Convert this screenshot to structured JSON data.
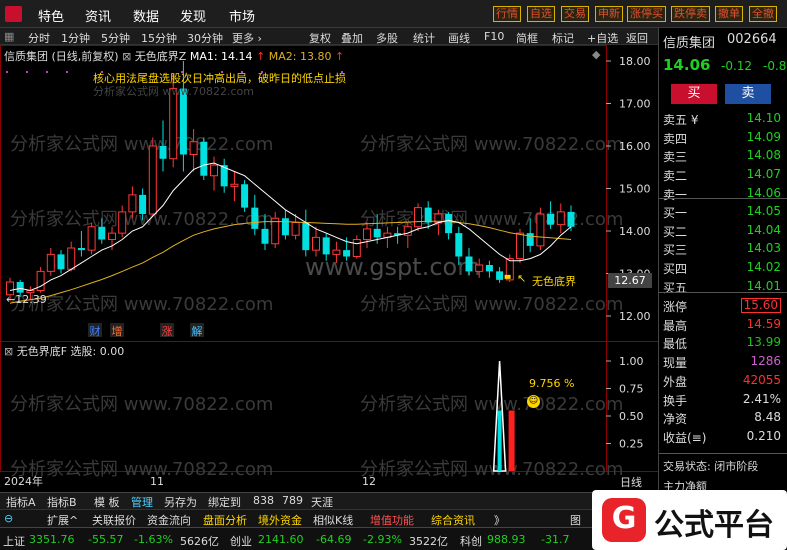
{
  "topbar": {
    "menu": [
      "特色",
      "资讯",
      "数据",
      "发现",
      "市场"
    ],
    "buttons": [
      "行情",
      "自选",
      "交易",
      "申新",
      "涨停买",
      "跌停卖",
      "撤单",
      "全撤"
    ]
  },
  "periodbar": {
    "items": [
      "分时",
      "1分钟",
      "5分钟",
      "15分钟",
      "30分钟",
      "更多 ›"
    ],
    "tools": [
      "复权",
      "叠加",
      "多股",
      "统计",
      "画线",
      "F10",
      "简框",
      "标记",
      "+自选",
      "返回"
    ]
  },
  "chart": {
    "title_line": {
      "stock": "信质集团 (日线,前复权)",
      "indicator": "无色底界Z",
      "ma1_label": "MA1: 14.14",
      "ma1_arrow": "↑",
      "ma2_label": "MA2: 13.80",
      "ma2_arrow": "↑"
    },
    "annotation_text": "核心用法尾盘选股次日冲高出局，破昨日的低点止损",
    "source_watermark": "分析家公式网 www.70822.com",
    "center_watermark": "www.gspt.com",
    "grid_watermark": "分析家公式网 www.70822.com",
    "low_marker": "←12.39",
    "current_price_tag": "12.67",
    "signal_label": "无色底界",
    "event_labels": [
      "财",
      "增",
      "涨",
      "解"
    ],
    "price_axis": [
      "18.00",
      "17.00",
      "16.00",
      "15.00",
      "14.00",
      "13.00",
      "12.00"
    ],
    "sub_title": {
      "name": "无色界底F",
      "value": "选股: 0.00"
    },
    "sub_axis": [
      "1.00",
      "0.75",
      "0.50",
      "0.25"
    ],
    "sub_pct_label": "9.756 %",
    "date_axis": [
      "2024年",
      "11",
      "12"
    ],
    "period_label": "日线"
  },
  "chart_data": {
    "type": "candlestick",
    "ylim": [
      11.7,
      18.3
    ],
    "candles": [
      [
        12.5,
        12.9,
        12.35,
        12.8
      ],
      [
        12.8,
        12.85,
        12.45,
        12.55
      ],
      [
        12.55,
        12.7,
        12.39,
        12.6
      ],
      [
        12.6,
        13.15,
        12.55,
        13.05
      ],
      [
        13.05,
        13.6,
        12.95,
        13.45
      ],
      [
        13.45,
        13.55,
        13.0,
        13.1
      ],
      [
        13.1,
        13.75,
        13.05,
        13.6
      ],
      [
        13.6,
        14.0,
        13.4,
        13.55
      ],
      [
        13.55,
        14.2,
        13.45,
        14.1
      ],
      [
        14.1,
        14.3,
        13.7,
        13.8
      ],
      [
        13.8,
        14.1,
        13.55,
        13.95
      ],
      [
        13.95,
        14.6,
        13.85,
        14.45
      ],
      [
        14.45,
        15.05,
        14.3,
        14.85
      ],
      [
        14.85,
        15.0,
        14.25,
        14.4
      ],
      [
        14.4,
        16.2,
        14.35,
        16.0
      ],
      [
        16.0,
        16.6,
        15.4,
        15.7
      ],
      [
        15.7,
        17.7,
        15.5,
        17.35
      ],
      [
        17.35,
        18.0,
        15.4,
        15.8
      ],
      [
        15.8,
        16.4,
        15.4,
        16.1
      ],
      [
        16.1,
        16.2,
        15.2,
        15.3
      ],
      [
        15.3,
        15.75,
        14.95,
        15.55
      ],
      [
        15.55,
        15.7,
        14.9,
        15.05
      ],
      [
        15.05,
        15.4,
        14.7,
        15.1
      ],
      [
        15.1,
        15.2,
        14.45,
        14.55
      ],
      [
        14.55,
        14.85,
        13.9,
        14.05
      ],
      [
        14.05,
        14.4,
        13.55,
        13.7
      ],
      [
        13.7,
        14.45,
        13.6,
        14.3
      ],
      [
        14.3,
        14.5,
        13.8,
        13.9
      ],
      [
        13.9,
        14.4,
        13.8,
        14.2
      ],
      [
        14.2,
        14.5,
        13.4,
        13.55
      ],
      [
        13.55,
        14.1,
        13.4,
        13.85
      ],
      [
        13.85,
        13.95,
        13.3,
        13.45
      ],
      [
        13.45,
        13.75,
        13.25,
        13.55
      ],
      [
        13.55,
        13.85,
        13.3,
        13.4
      ],
      [
        13.4,
        13.9,
        13.35,
        13.8
      ],
      [
        13.8,
        14.2,
        13.6,
        14.05
      ],
      [
        14.05,
        14.4,
        13.7,
        13.85
      ],
      [
        13.85,
        14.1,
        13.6,
        13.95
      ],
      [
        13.95,
        14.1,
        13.7,
        13.9
      ],
      [
        13.9,
        14.2,
        13.6,
        14.1
      ],
      [
        14.1,
        14.65,
        14.0,
        14.55
      ],
      [
        14.55,
        14.7,
        14.05,
        14.2
      ],
      [
        14.2,
        14.5,
        13.9,
        14.4
      ],
      [
        14.4,
        14.45,
        13.8,
        13.95
      ],
      [
        13.95,
        14.1,
        13.2,
        13.4
      ],
      [
        13.4,
        13.6,
        12.95,
        13.05
      ],
      [
        13.05,
        13.35,
        12.9,
        13.2
      ],
      [
        13.2,
        13.3,
        12.9,
        13.05
      ],
      [
        13.05,
        13.15,
        12.78,
        12.85
      ],
      [
        12.85,
        13.45,
        12.8,
        13.35
      ],
      [
        13.35,
        14.05,
        13.25,
        13.95
      ],
      [
        13.95,
        14.3,
        13.5,
        13.65
      ],
      [
        13.65,
        14.55,
        13.55,
        14.4
      ],
      [
        14.4,
        14.7,
        14.05,
        14.15
      ],
      [
        14.15,
        14.65,
        13.95,
        14.45
      ],
      [
        14.45,
        14.6,
        14.0,
        14.1
      ]
    ],
    "ma1": [
      12.6,
      12.65,
      12.6,
      12.7,
      12.85,
      12.95,
      13.1,
      13.25,
      13.4,
      13.55,
      13.65,
      13.8,
      14.0,
      14.1,
      14.35,
      14.6,
      14.95,
      15.2,
      15.45,
      15.55,
      15.6,
      15.5,
      15.4,
      15.3,
      15.1,
      14.9,
      14.7,
      14.5,
      14.35,
      14.2,
      14.05,
      13.95,
      13.85,
      13.75,
      13.7,
      13.75,
      13.8,
      13.85,
      13.9,
      13.95,
      14.05,
      14.1,
      14.2,
      14.25,
      14.2,
      14.05,
      13.85,
      13.65,
      13.45,
      13.3,
      13.3,
      13.35,
      13.45,
      13.65,
      13.9,
      14.1
    ],
    "ma2": [
      12.3,
      12.35,
      12.38,
      12.42,
      12.48,
      12.55,
      12.62,
      12.7,
      12.78,
      12.86,
      12.95,
      13.05,
      13.15,
      13.25,
      13.38,
      13.5,
      13.65,
      13.78,
      13.9,
      13.98,
      14.05,
      14.1,
      14.15,
      14.18,
      14.2,
      14.22,
      14.22,
      14.22,
      14.21,
      14.2,
      14.19,
      14.18,
      14.17,
      14.16,
      14.16,
      14.17,
      14.18,
      14.19,
      14.2,
      14.21,
      14.22,
      14.23,
      14.23,
      14.22,
      14.2,
      14.17,
      14.13,
      14.08,
      14.02,
      13.96,
      13.92,
      13.88,
      13.86,
      13.84,
      13.82,
      13.8
    ],
    "signal_index": 48,
    "sub_signal": {
      "index": 48,
      "value": 1.0
    },
    "series_names": [
      "MA1",
      "MA2"
    ]
  },
  "rightpanel": {
    "stock_name": "信质集团",
    "stock_code": "002664",
    "price": "14.06",
    "change": "-0.12",
    "change_pct": "-0.8",
    "buy_btn": "买",
    "sell_btn": "卖",
    "asks": [
      {
        "label": "卖五 ¥",
        "price": "14.10"
      },
      {
        "label": "卖四",
        "price": "14.09"
      },
      {
        "label": "卖三",
        "price": "14.08"
      },
      {
        "label": "卖二",
        "price": "14.07"
      },
      {
        "label": "卖一",
        "price": "14.06"
      }
    ],
    "bids": [
      {
        "label": "买一",
        "price": "14.05"
      },
      {
        "label": "买二",
        "price": "14.04"
      },
      {
        "label": "买三",
        "price": "14.03"
      },
      {
        "label": "买四",
        "price": "14.02"
      },
      {
        "label": "买五",
        "price": "14.01"
      }
    ],
    "stats": [
      {
        "label": "涨停",
        "value": "15.60",
        "color": "#ff3030",
        "boxed": true
      },
      {
        "label": "最高",
        "value": "14.59",
        "color": "#ff3030"
      },
      {
        "label": "最低",
        "value": "13.99",
        "color": "#20c020"
      },
      {
        "label": "现量",
        "value": "1286",
        "color": "#d060d0"
      },
      {
        "label": "外盘",
        "value": "42055",
        "color": "#ff3030"
      },
      {
        "label": "换手",
        "value": "2.41%",
        "color": "#dddddd"
      },
      {
        "label": "净资",
        "value": "8.48",
        "color": "#dddddd"
      },
      {
        "label": "收益(≡)",
        "value": "0.210",
        "color": "#dddddd"
      }
    ],
    "trade_status": "交易状态: 闭市阶段",
    "bottom_label": "主力净额"
  },
  "tabbar": {
    "items": [
      "指标A",
      "指标B",
      "模 板",
      "管理",
      "另存为",
      "绑定到",
      "838",
      "789",
      "天涯"
    ]
  },
  "funcbar": {
    "items": [
      "扩展^",
      "关联报价",
      "资金流向",
      "盘面分析",
      "境外资金",
      "相似K线",
      "增值功能",
      "综合资讯",
      "》",
      "图"
    ]
  },
  "statusbar": {
    "sh_label": "上证",
    "sh_value": "3351.76",
    "sh_change": "-55.57",
    "sh_pct": "-1.63%",
    "sh_amount": "5626亿",
    "cy_label": "创业",
    "cy_value": "2141.60",
    "cy_change": "-64.69",
    "cy_pct": "-2.93%",
    "cy_amount": "3522亿",
    "kc_label": "科创",
    "kc_value": "988.93",
    "kc_change": "-31.7"
  },
  "brand": {
    "text": "公式平台",
    "logo": "G"
  },
  "colors": {
    "up": "#ff3838",
    "down": "#00e0e0",
    "ma1": "#ffffff",
    "ma2": "#e0b020",
    "grid": "#8b0000"
  }
}
